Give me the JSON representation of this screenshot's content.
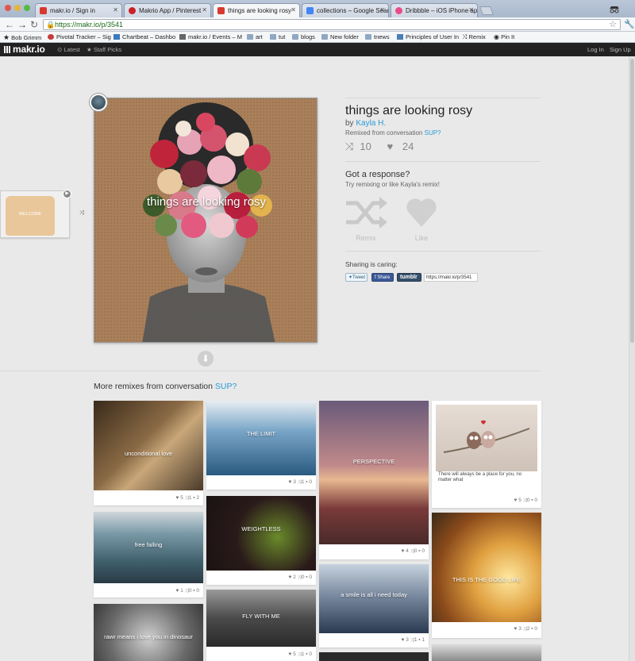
{
  "browser": {
    "tabs": [
      {
        "title": "makr.io / Sign in",
        "favicon_color": "#d8382e"
      },
      {
        "title": "Makrio App / Pinterest",
        "favicon_color": "#cb2027"
      },
      {
        "title": "things are looking rosy",
        "favicon_color": "#d8382e"
      },
      {
        "title": "collections – Google Search",
        "favicon_color": "#4285f4"
      },
      {
        "title": "Dribbble – iOS iPhone app d",
        "favicon_color": "#ea4c89"
      }
    ],
    "url": "https://makr.io/p/3541",
    "bookmarks": [
      "Bob Grimm",
      "Pivotal Tracker – Sig",
      "Chartbeat – Dashbo",
      "makr.io / Events – M",
      "art",
      "tut",
      "blogs",
      "New folder",
      "tnews",
      "Principles of User In",
      "Remix",
      "Pin It"
    ]
  },
  "site": {
    "logo": "makr.io",
    "nav": {
      "latest": "Latest",
      "staff_picks": "Staff Picks"
    },
    "login": "Log In",
    "signup": "Sign Up"
  },
  "post": {
    "image_caption": "things are looking rosy",
    "title": "things are looking rosy",
    "by": "by",
    "author": "Kayla H.",
    "remixed_from": "Remixed from conversation",
    "conversation": "SUP?",
    "remix_count": "10",
    "like_count": "24",
    "response_title": "Got a response?",
    "response_sub": "Try remixing or like Kayla's remix!",
    "remix_label": "Remix",
    "like_label": "Like",
    "share_title": "Sharing is caring:",
    "tweet": "Tweet",
    "facebook_share": "Share",
    "tumblr": "tumblr",
    "share_url": "https://makr.io/p/3541",
    "prev_label": "WELCOME"
  },
  "more": {
    "title": "More remixes from conversation",
    "conversation": "SUP?",
    "cards": [
      {
        "caption": "unconditional love",
        "likes": "5",
        "remixes": "1",
        "comments": "2",
        "color": "#6b5a45"
      },
      {
        "caption": "THE LIMIT",
        "likes": "3",
        "remixes": "1",
        "comments": "0",
        "color": "#3f6f95"
      },
      {
        "caption": "PERSPECTIVE",
        "likes": "4",
        "remixes": "0",
        "comments": "0",
        "color": "#7a4a5a"
      },
      {
        "caption": "There will always be a place for you, no matter what",
        "likes": "5",
        "remixes": "0",
        "comments": "0",
        "color": "#b9a89a"
      },
      {
        "caption": "free falling",
        "likes": "1",
        "remixes": "0",
        "comments": "0",
        "color": "#5f7a86"
      },
      {
        "caption": "WEIGHTLESS",
        "likes": "2",
        "remixes": "0",
        "comments": "0",
        "color": "#3a2a2a"
      },
      {
        "caption": "a smile is all i need today",
        "likes": "3",
        "remixes": "1",
        "comments": "1",
        "color": "#55657a"
      },
      {
        "caption": "THIS IS THE GOOD LIFE",
        "likes": "3",
        "remixes": "2",
        "comments": "0",
        "color": "#b3702c"
      },
      {
        "caption": "rawr means i love you in dinosaur",
        "likes": "",
        "remixes": "",
        "comments": "",
        "color": "#777"
      },
      {
        "caption": "FLY WITH ME",
        "likes": "5",
        "remixes": "1",
        "comments": "0",
        "color": "#555"
      }
    ]
  }
}
